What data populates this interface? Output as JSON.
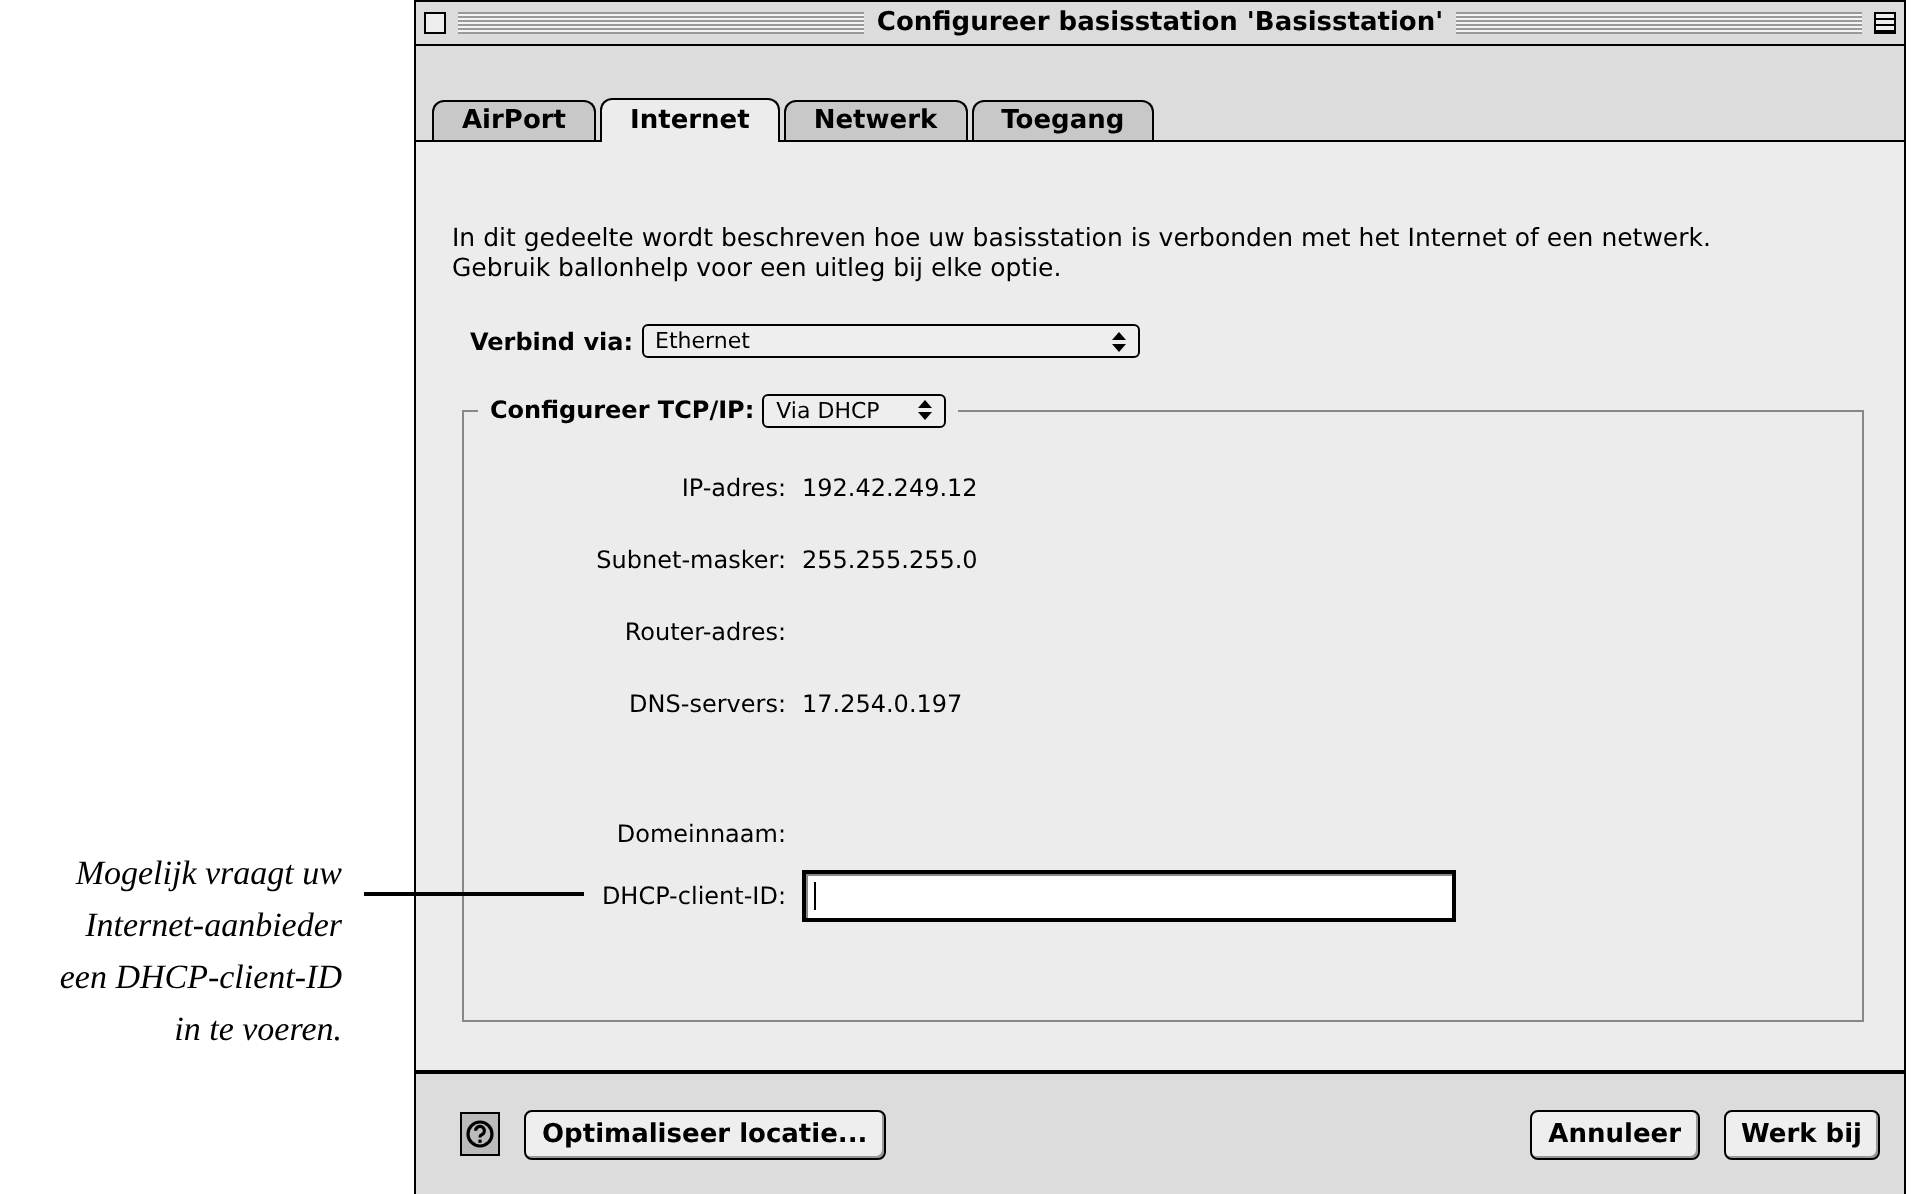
{
  "callout": "Mogelijk vraagt uw Internet-aanbieder een DHCP-client-ID in te voeren.",
  "window": {
    "title": "Configureer basisstation 'Basisstation'"
  },
  "tabs": [
    {
      "label": "AirPort",
      "selected": false
    },
    {
      "label": "Internet",
      "selected": true
    },
    {
      "label": "Netwerk",
      "selected": false
    },
    {
      "label": "Toegang",
      "selected": false
    }
  ],
  "description": [
    "In dit gedeelte wordt beschreven hoe uw basisstation is verbonden met het Internet of een netwerk.",
    "Gebruik ballonhelp voor een uitleg bij elke optie."
  ],
  "connect": {
    "label": "Verbind via:",
    "value": "Ethernet"
  },
  "tcpip": {
    "label": "Configureer TCP/IP:",
    "value": "Via DHCP"
  },
  "fields": [
    {
      "kind": "text",
      "label": "IP-adres:",
      "value": "192.42.249.12"
    },
    {
      "kind": "text",
      "label": "Subnet-masker:",
      "value": "255.255.255.0"
    },
    {
      "kind": "text",
      "label": "Router-adres:"
    },
    {
      "kind": "text",
      "label": "DNS-servers:",
      "value": "17.254.0.197"
    },
    {
      "kind": "text",
      "label": "Domeinnaam:"
    },
    {
      "kind": "input",
      "label": "DHCP-client-ID:",
      "focused": true
    }
  ],
  "buttons": {
    "left": "Optimaliseer locatie...",
    "right": [
      "Annuleer",
      "Werk bij"
    ]
  }
}
